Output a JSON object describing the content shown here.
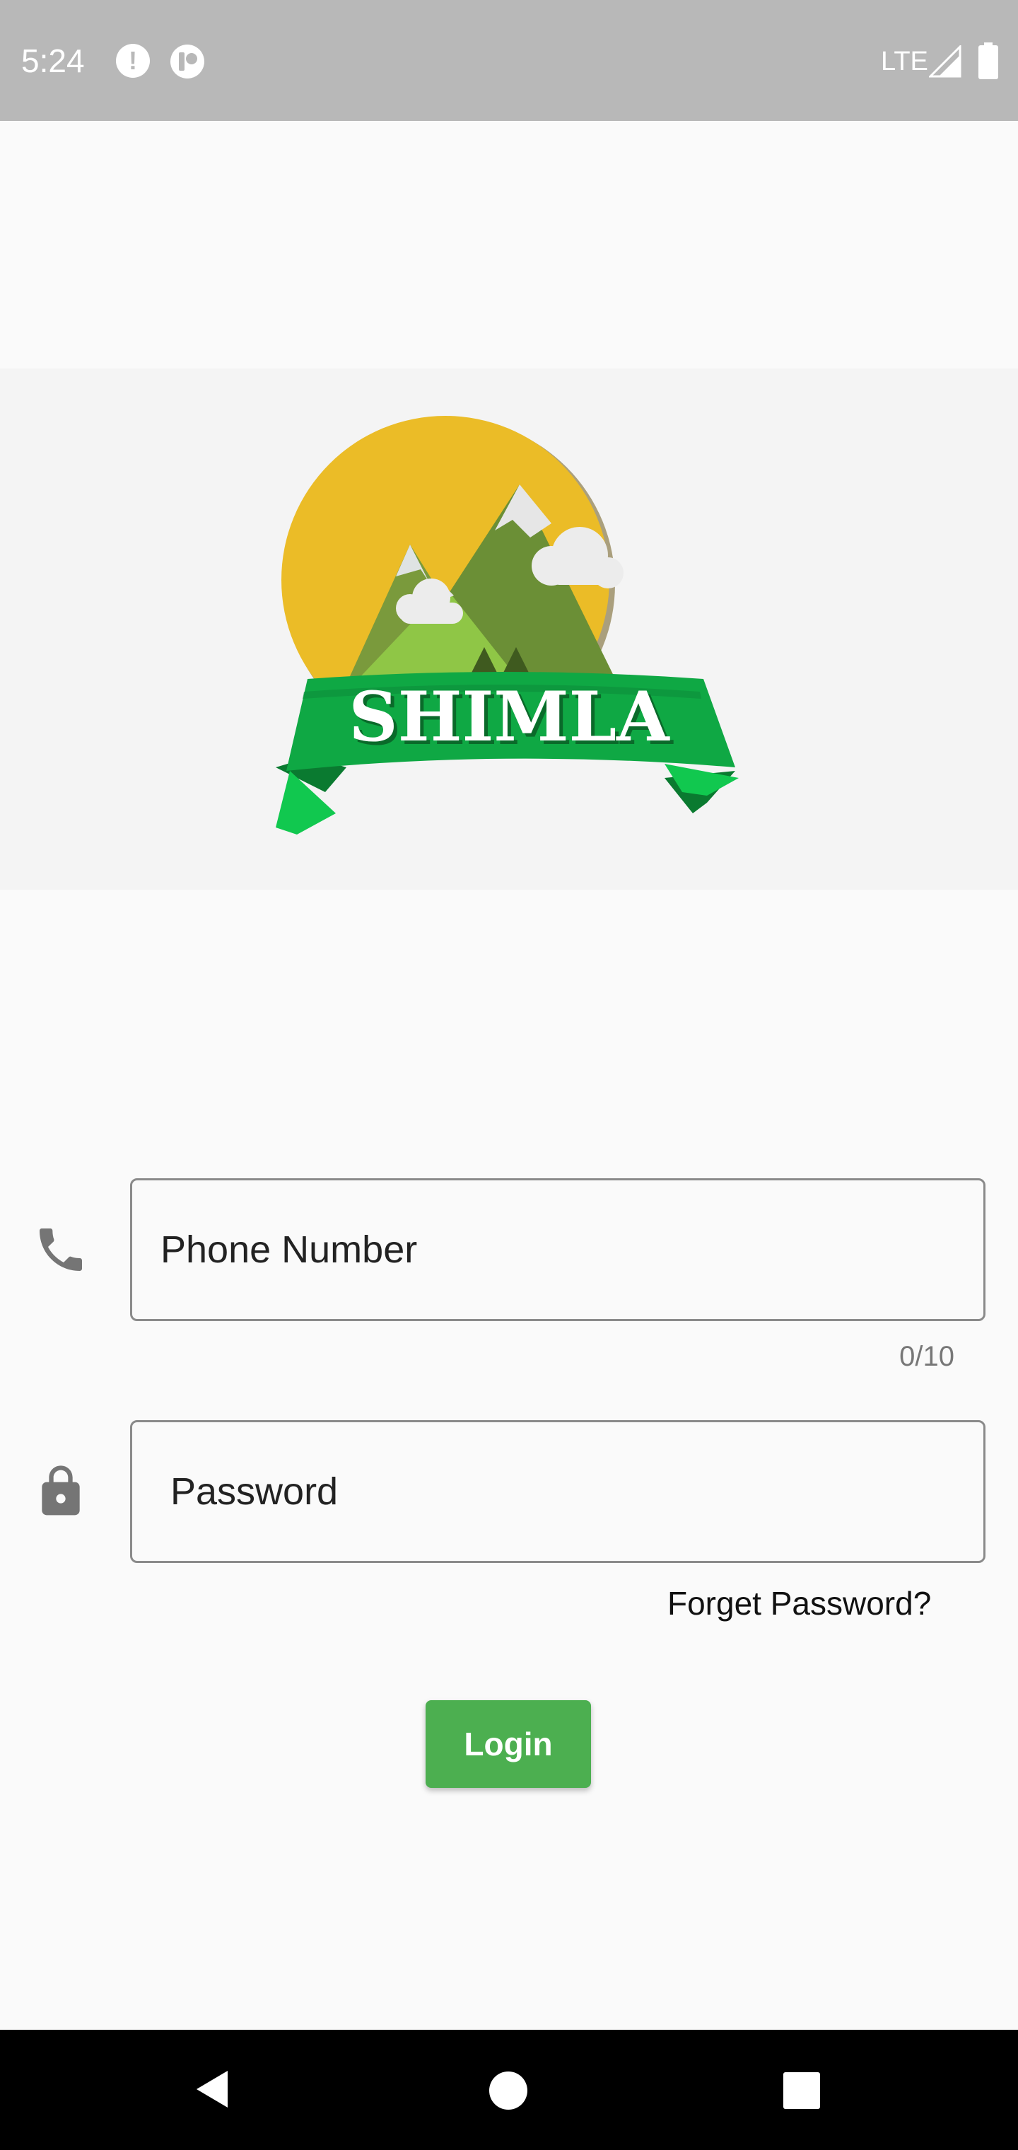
{
  "status_bar": {
    "time": "5:24",
    "network": "LTE",
    "icons": [
      "alert-icon",
      "app-notification-icon",
      "signal-icon",
      "battery-icon"
    ]
  },
  "logo": {
    "text": "SHIMLA",
    "colors": {
      "sun": "#ebbc27",
      "ribbon": "#0fa844",
      "mountain_dark": "#6b8f36",
      "mountain_light": "#8fc646"
    }
  },
  "form": {
    "phone": {
      "icon": "phone-icon",
      "placeholder": "Phone Number",
      "value": "",
      "counter": "0/10"
    },
    "password": {
      "icon": "lock-icon",
      "placeholder": "Password",
      "value": ""
    },
    "forget_password": "Forget Password?",
    "login_label": "Login",
    "accent_color": "#4caf50"
  },
  "nav_bar": {
    "icons": [
      "back-icon",
      "home-icon",
      "recents-icon"
    ]
  }
}
